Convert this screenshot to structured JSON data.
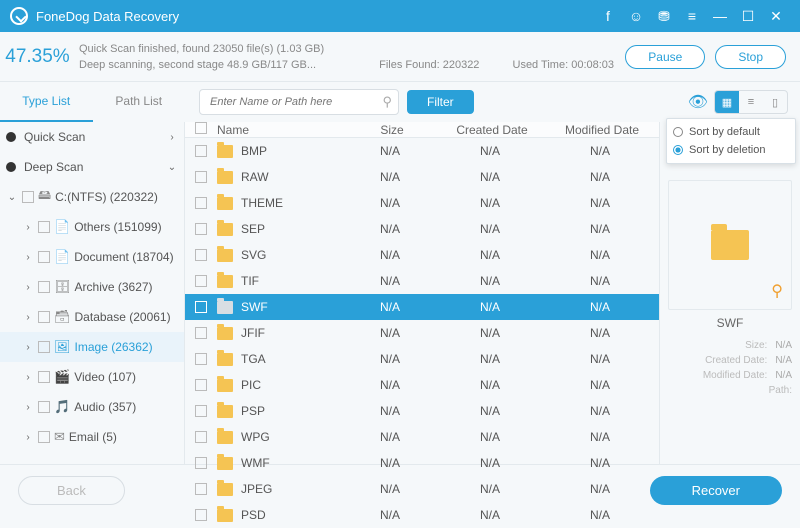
{
  "app": {
    "title": "FoneDog Data Recovery"
  },
  "status": {
    "pct": "47.35%",
    "line1": "Quick Scan finished, found 23050 file(s) (1.03 GB)",
    "line2": "Deep scanning, second stage 48.9 GB/117 GB...",
    "filesFoundLabel": "Files Found:",
    "filesFound": "220322",
    "usedLabel": "Used Time:",
    "used": "00:08:03",
    "pause": "Pause",
    "stop": "Stop"
  },
  "tabs": {
    "type": "Type List",
    "path": "Path List"
  },
  "search": {
    "placeholder": "Enter Name or Path here"
  },
  "filter": "Filter",
  "tree": {
    "quick": "Quick Scan",
    "deep": "Deep Scan",
    "drive": "C:(NTFS) (220322)",
    "items": [
      {
        "label": "Others (151099)"
      },
      {
        "label": "Document (18704)"
      },
      {
        "label": "Archive (3627)"
      },
      {
        "label": "Database (20061)"
      },
      {
        "label": "Image (26362)"
      },
      {
        "label": "Video (107)"
      },
      {
        "label": "Audio (357)"
      },
      {
        "label": "Email (5)"
      }
    ]
  },
  "cols": {
    "name": "Name",
    "size": "Size",
    "cd": "Created Date",
    "md": "Modified Date"
  },
  "files": [
    {
      "name": "BMP",
      "size": "N/A",
      "cd": "N/A",
      "md": "N/A"
    },
    {
      "name": "RAW",
      "size": "N/A",
      "cd": "N/A",
      "md": "N/A"
    },
    {
      "name": "THEME",
      "size": "N/A",
      "cd": "N/A",
      "md": "N/A"
    },
    {
      "name": "SEP",
      "size": "N/A",
      "cd": "N/A",
      "md": "N/A"
    },
    {
      "name": "SVG",
      "size": "N/A",
      "cd": "N/A",
      "md": "N/A"
    },
    {
      "name": "TIF",
      "size": "N/A",
      "cd": "N/A",
      "md": "N/A"
    },
    {
      "name": "SWF",
      "size": "N/A",
      "cd": "N/A",
      "md": "N/A",
      "sel": true
    },
    {
      "name": "JFIF",
      "size": "N/A",
      "cd": "N/A",
      "md": "N/A"
    },
    {
      "name": "TGA",
      "size": "N/A",
      "cd": "N/A",
      "md": "N/A"
    },
    {
      "name": "PIC",
      "size": "N/A",
      "cd": "N/A",
      "md": "N/A"
    },
    {
      "name": "PSP",
      "size": "N/A",
      "cd": "N/A",
      "md": "N/A"
    },
    {
      "name": "WPG",
      "size": "N/A",
      "cd": "N/A",
      "md": "N/A"
    },
    {
      "name": "WMF",
      "size": "N/A",
      "cd": "N/A",
      "md": "N/A"
    },
    {
      "name": "JPEG",
      "size": "N/A",
      "cd": "N/A",
      "md": "N/A"
    },
    {
      "name": "PSD",
      "size": "N/A",
      "cd": "N/A",
      "md": "N/A"
    }
  ],
  "sort": {
    "def": "Sort by default",
    "del": "Sort by deletion"
  },
  "preview": {
    "name": "SWF",
    "sizeL": "Size:",
    "size": "N/A",
    "cdL": "Created Date:",
    "cd": "N/A",
    "mdL": "Modified Date:",
    "md": "N/A",
    "pathL": "Path:"
  },
  "footer": {
    "back": "Back",
    "recover": "Recover"
  },
  "na": "N/A"
}
